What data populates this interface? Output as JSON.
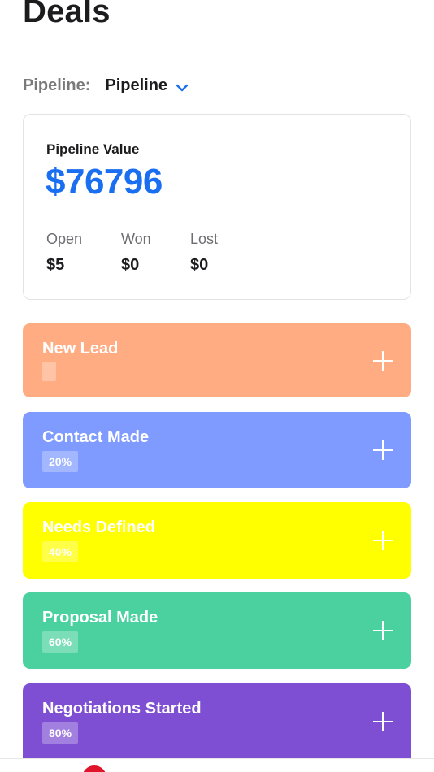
{
  "page": {
    "title": "Deals"
  },
  "pipeline": {
    "label": "Pipeline:",
    "selected": "Pipeline"
  },
  "summary": {
    "label": "Pipeline Value",
    "value": "$76796",
    "stats": [
      {
        "label": "Open",
        "value": "$5"
      },
      {
        "label": "Won",
        "value": "$0"
      },
      {
        "label": "Lost",
        "value": "$0"
      }
    ]
  },
  "stages": [
    {
      "name": "New Lead",
      "badge": "",
      "color": "#ffac83"
    },
    {
      "name": "Contact Made",
      "badge": "20%",
      "color": "#7f9bff"
    },
    {
      "name": "Needs Defined",
      "badge": "40%",
      "color": "#ffff00"
    },
    {
      "name": "Proposal Made",
      "badge": "60%",
      "color": "#4ad19f"
    },
    {
      "name": "Negotiations Started",
      "badge": "80%",
      "color": "#7e4fd3"
    }
  ],
  "icons": {
    "dropdown": "chevron-down-icon",
    "add": "plus-icon"
  },
  "colors": {
    "accent": "#1a6ef0",
    "notification": "#e0152b"
  }
}
